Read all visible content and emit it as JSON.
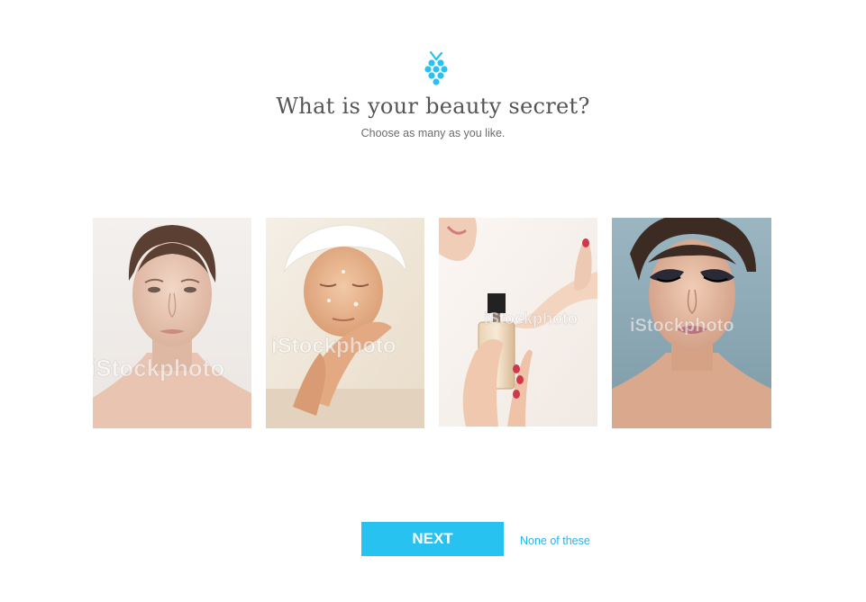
{
  "header": {
    "logo_icon": "grape-icon",
    "title": "What is your beauty secret?",
    "subtitle": "Choose as many as you like."
  },
  "options": [
    {
      "icon": "photo-natural-skin",
      "watermark": "iStockphoto"
    },
    {
      "icon": "photo-face-wash",
      "watermark": "iStockphoto"
    },
    {
      "icon": "photo-perfume",
      "watermark": "iStockphoto"
    },
    {
      "icon": "photo-makeup",
      "watermark": "iStockphoto"
    }
  ],
  "actions": {
    "next_label": "NEXT",
    "none_label": "None of these"
  },
  "colors": {
    "accent": "#27c2f0",
    "link": "#27b3e6",
    "title_text": "#555555",
    "subtitle_text": "#6b6b6b"
  }
}
